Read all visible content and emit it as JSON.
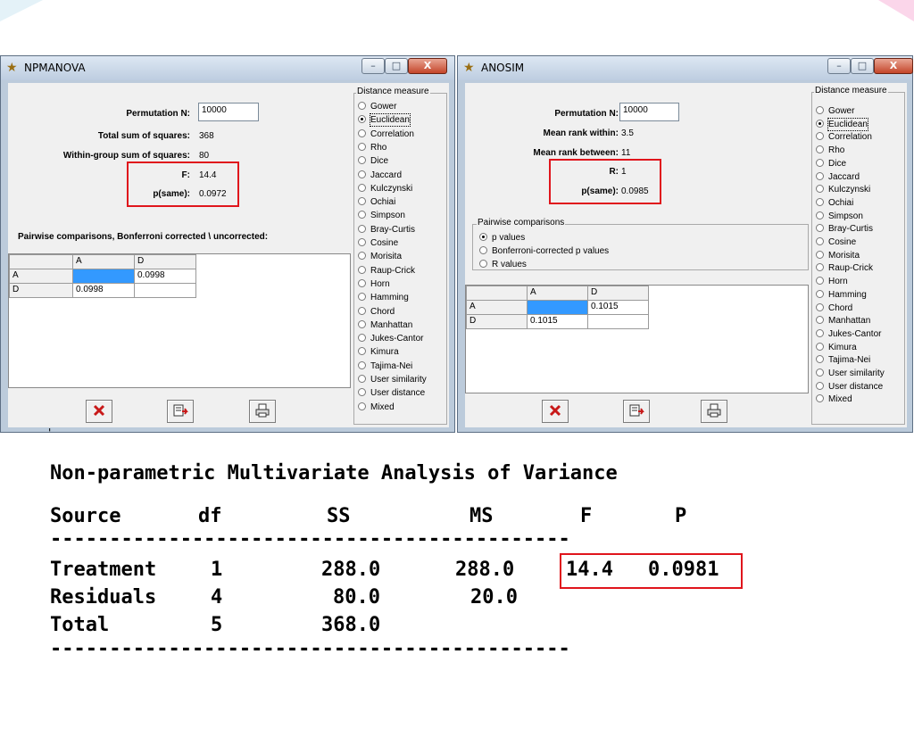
{
  "npmanova": {
    "title": "NPMANOVA",
    "controls": {
      "minimize": "–",
      "maximize": "□",
      "close": "X"
    },
    "permutation_label": "Permutation N:",
    "permutation_value": "10000",
    "total_ss_label": "Total sum of squares:",
    "total_ss_value": "368",
    "within_ss_label": "Within-group sum of squares:",
    "within_ss_value": "80",
    "f_label": "F:",
    "f_value": "14.4",
    "psame_label": "p(same):",
    "psame_value": "0.0972",
    "pairwise_label": "Pairwise comparisons, Bonferroni corrected \\ uncorrected:",
    "grid": {
      "columns": [
        "A",
        "D"
      ],
      "rows": [
        {
          "label": "A",
          "cells": [
            "",
            "0.0998"
          ]
        },
        {
          "label": "D",
          "cells": [
            "0.0998",
            ""
          ]
        }
      ]
    },
    "buttons": {
      "close_icon": "red-x-icon",
      "copy_icon": "copy-icon",
      "print_icon": "print-icon"
    }
  },
  "anosim": {
    "title": "ANOSIM",
    "controls": {
      "minimize": "–",
      "maximize": "□",
      "close": "X"
    },
    "permutation_label": "Permutation N:",
    "permutation_value": "10000",
    "mean_within_label": "Mean rank within:",
    "mean_within_value": "3.5",
    "mean_between_label": "Mean rank between:",
    "mean_between_value": "11",
    "r_label": "R:",
    "r_value": "1",
    "psame_label": "p(same):",
    "psame_value": "0.0985",
    "pairwise_group_title": "Pairwise comparisons",
    "pairwise_options": [
      "p values",
      "Bonferroni-corrected p values",
      "R values"
    ],
    "pairwise_selected": "p values",
    "grid": {
      "columns": [
        "A",
        "D"
      ],
      "rows": [
        {
          "label": "A",
          "cells": [
            "",
            "0.1015"
          ]
        },
        {
          "label": "D",
          "cells": [
            "0.1015",
            ""
          ]
        }
      ]
    }
  },
  "distance_measure": {
    "title": "Distance measure",
    "selected": "Euclidean",
    "options": [
      "Gower",
      "Euclidean",
      "Correlation",
      "Rho",
      "Dice",
      "Jaccard",
      "Kulczynski",
      "Ochiai",
      "Simpson",
      "Bray-Curtis",
      "Cosine",
      "Morisita",
      "Raup-Crick",
      "Horn",
      "Hamming",
      "Chord",
      "Manhattan",
      "Jukes-Cantor",
      "Kimura",
      "Tajima-Nei",
      "User similarity",
      "User distance",
      "Mixed"
    ]
  },
  "stray_mark": "'",
  "summary": {
    "title": "Non-parametric Multivariate Analysis of Variance",
    "headers": [
      "Source",
      "df",
      "SS",
      "MS",
      "F",
      "P"
    ],
    "rule": "--------------------------------------------",
    "rows": [
      [
        "Treatment",
        "1",
        "288.0",
        "288.0",
        "14.4",
        "0.0981"
      ],
      [
        "Residuals",
        "4",
        "80.0",
        "20.0",
        "",
        ""
      ],
      [
        "Total",
        "5",
        "368.0",
        "",
        "",
        ""
      ]
    ]
  },
  "colors": {
    "highlight_box": "#e0151c",
    "selected_cell": "#3399ff"
  }
}
